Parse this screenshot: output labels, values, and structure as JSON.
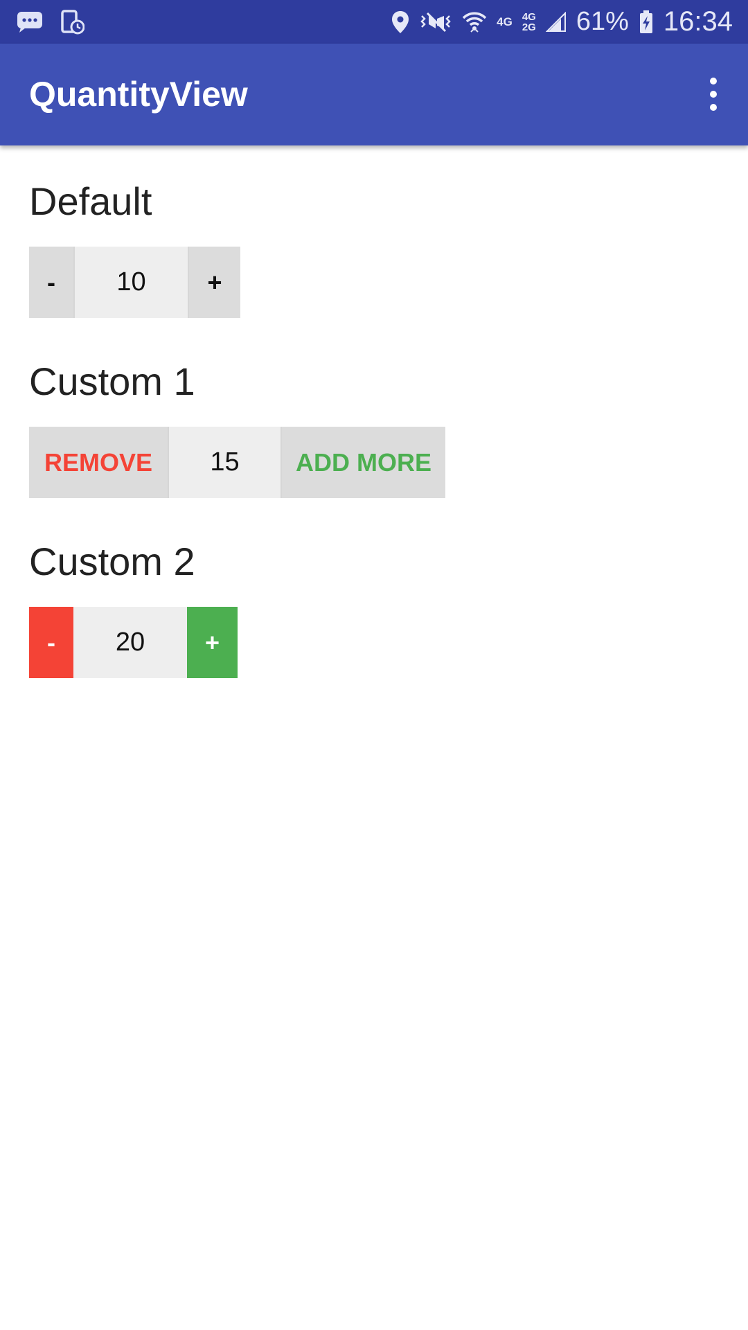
{
  "status_bar": {
    "left_icons": [
      "messages-icon",
      "device-timer-icon"
    ],
    "right_icons": [
      "location-icon",
      "vibrate-icon",
      "wifi-icon",
      "signal-icon",
      "battery-charging-icon"
    ],
    "network_4g": "4G",
    "network_4g_2g_top": "4G",
    "network_4g_2g_bottom": "2G",
    "battery_percent": "61%",
    "time": "16:34"
  },
  "app_bar": {
    "title": "QuantityView",
    "menu_icon": "more-vertical-icon"
  },
  "sections": [
    {
      "title": "Default",
      "remove_label": "-",
      "value": "10",
      "add_label": "+",
      "remove_color": "#111111",
      "add_color": "#111111",
      "remove_bg": "#dcdcdc",
      "add_bg": "#dcdcdc"
    },
    {
      "title": "Custom 1",
      "remove_label": "REMOVE",
      "value": "15",
      "add_label": "ADD MORE",
      "remove_color": "#f44336",
      "add_color": "#4caf50",
      "remove_bg": "#dcdcdc",
      "add_bg": "#dcdcdc"
    },
    {
      "title": "Custom 2",
      "remove_label": "-",
      "value": "20",
      "add_label": "+",
      "remove_color": "#ffffff",
      "add_color": "#ffffff",
      "remove_bg": "#f44336",
      "add_bg": "#4caf50"
    }
  ],
  "colors": {
    "status_bar": "#2f3c9e",
    "primary": "#3f51b5",
    "accent_red": "#f44336",
    "accent_green": "#4caf50"
  }
}
